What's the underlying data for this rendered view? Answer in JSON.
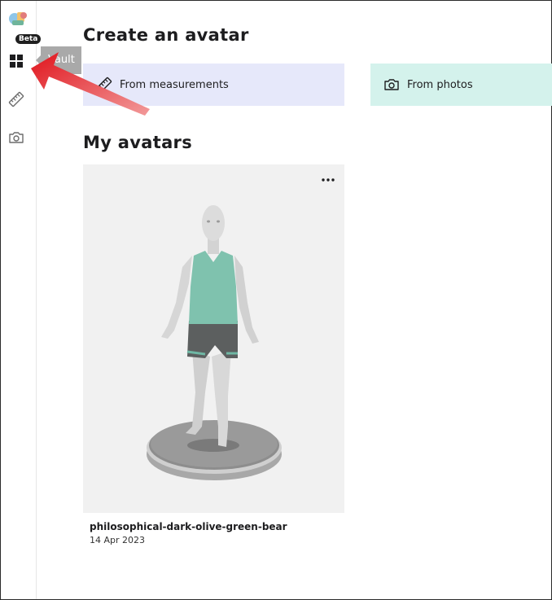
{
  "sidebar": {
    "logo_badge": "Beta",
    "items": [
      {
        "icon": "grid-icon",
        "tooltip": "Vault"
      },
      {
        "icon": "ruler-icon"
      },
      {
        "icon": "camera-icon"
      }
    ]
  },
  "main": {
    "create_heading": "Create an avatar",
    "create_options": [
      {
        "label": "From measurements",
        "icon": "ruler-icon",
        "color": "#e6e8fa"
      },
      {
        "label": "From photos",
        "icon": "camera-icon",
        "color": "#d4f2ec"
      }
    ],
    "my_heading": "My avatars",
    "avatars": [
      {
        "name": "philosophical-dark-olive-green-bear",
        "date": "14 Apr 2023"
      }
    ]
  },
  "annotation": {
    "color": "#e0141c"
  }
}
